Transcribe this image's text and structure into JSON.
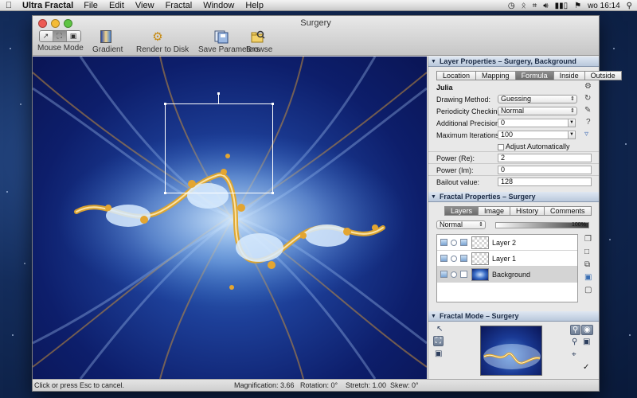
{
  "menubar": {
    "apple_icon": "apple-icon",
    "app_name": "Ultra Fractal",
    "items": [
      "File",
      "Edit",
      "View",
      "Fractal",
      "Window",
      "Help"
    ],
    "status_icons": [
      "time-machine-icon",
      "bluetooth-icon",
      "wifi-icon",
      "volume-icon",
      "battery-icon",
      "flag-icon"
    ],
    "clock": "wo 16:14",
    "search_icon": "spotlight-icon"
  },
  "window": {
    "title": "Surgery",
    "toolbar": {
      "mouse_mode_label": "Mouse Mode",
      "gradient_label": "Gradient",
      "render_label": "Render to Disk",
      "save_params_label": "Save Parameters",
      "browse_label": "Browse"
    }
  },
  "statusbar": {
    "hint": "Click or press Esc to cancel.",
    "magnification": "Magnification: 3.66",
    "rotation": "Rotation: 0°",
    "stretch": "Stretch: 1.00",
    "skew": "Skew: 0°"
  },
  "layer_properties": {
    "header": "Layer Properties – Surgery, Background",
    "tabs": [
      "Location",
      "Mapping",
      "Formula",
      "Inside",
      "Outside"
    ],
    "selected_tab": "Formula",
    "formula_name": "Julia",
    "params": {
      "drawing_method_label": "Drawing Method:",
      "drawing_method_value": "Guessing",
      "periodicity_label": "Periodicity Checking:",
      "periodicity_value": "Normal",
      "precision_label": "Additional Precision:",
      "precision_value": "0",
      "max_iter_label": "Maximum Iterations:",
      "max_iter_value": "100",
      "adjust_label": "Adjust Automatically",
      "power_re_label": "Power (Re):",
      "power_re_value": "2",
      "power_im_label": "Power (Im):",
      "power_im_value": "0",
      "bailout_label": "Bailout value:",
      "bailout_value": "128"
    }
  },
  "fractal_properties": {
    "header": "Fractal Properties – Surgery",
    "tabs": [
      "Layers",
      "Image",
      "History",
      "Comments"
    ],
    "selected_tab": "Layers",
    "merge_mode": "Normal",
    "opacity": "100%",
    "layers": [
      {
        "name": "Layer 2"
      },
      {
        "name": "Layer 1"
      },
      {
        "name": "Background"
      }
    ]
  },
  "fractal_mode": {
    "header": "Fractal Mode – Surgery"
  },
  "colors": {
    "canvas_dark": "#0a1555",
    "canvas_mid": "#1d3f98",
    "gold": "#e0a52a",
    "panel_header": "#b9c8dc",
    "selected_tab": "#6c6c6c"
  }
}
